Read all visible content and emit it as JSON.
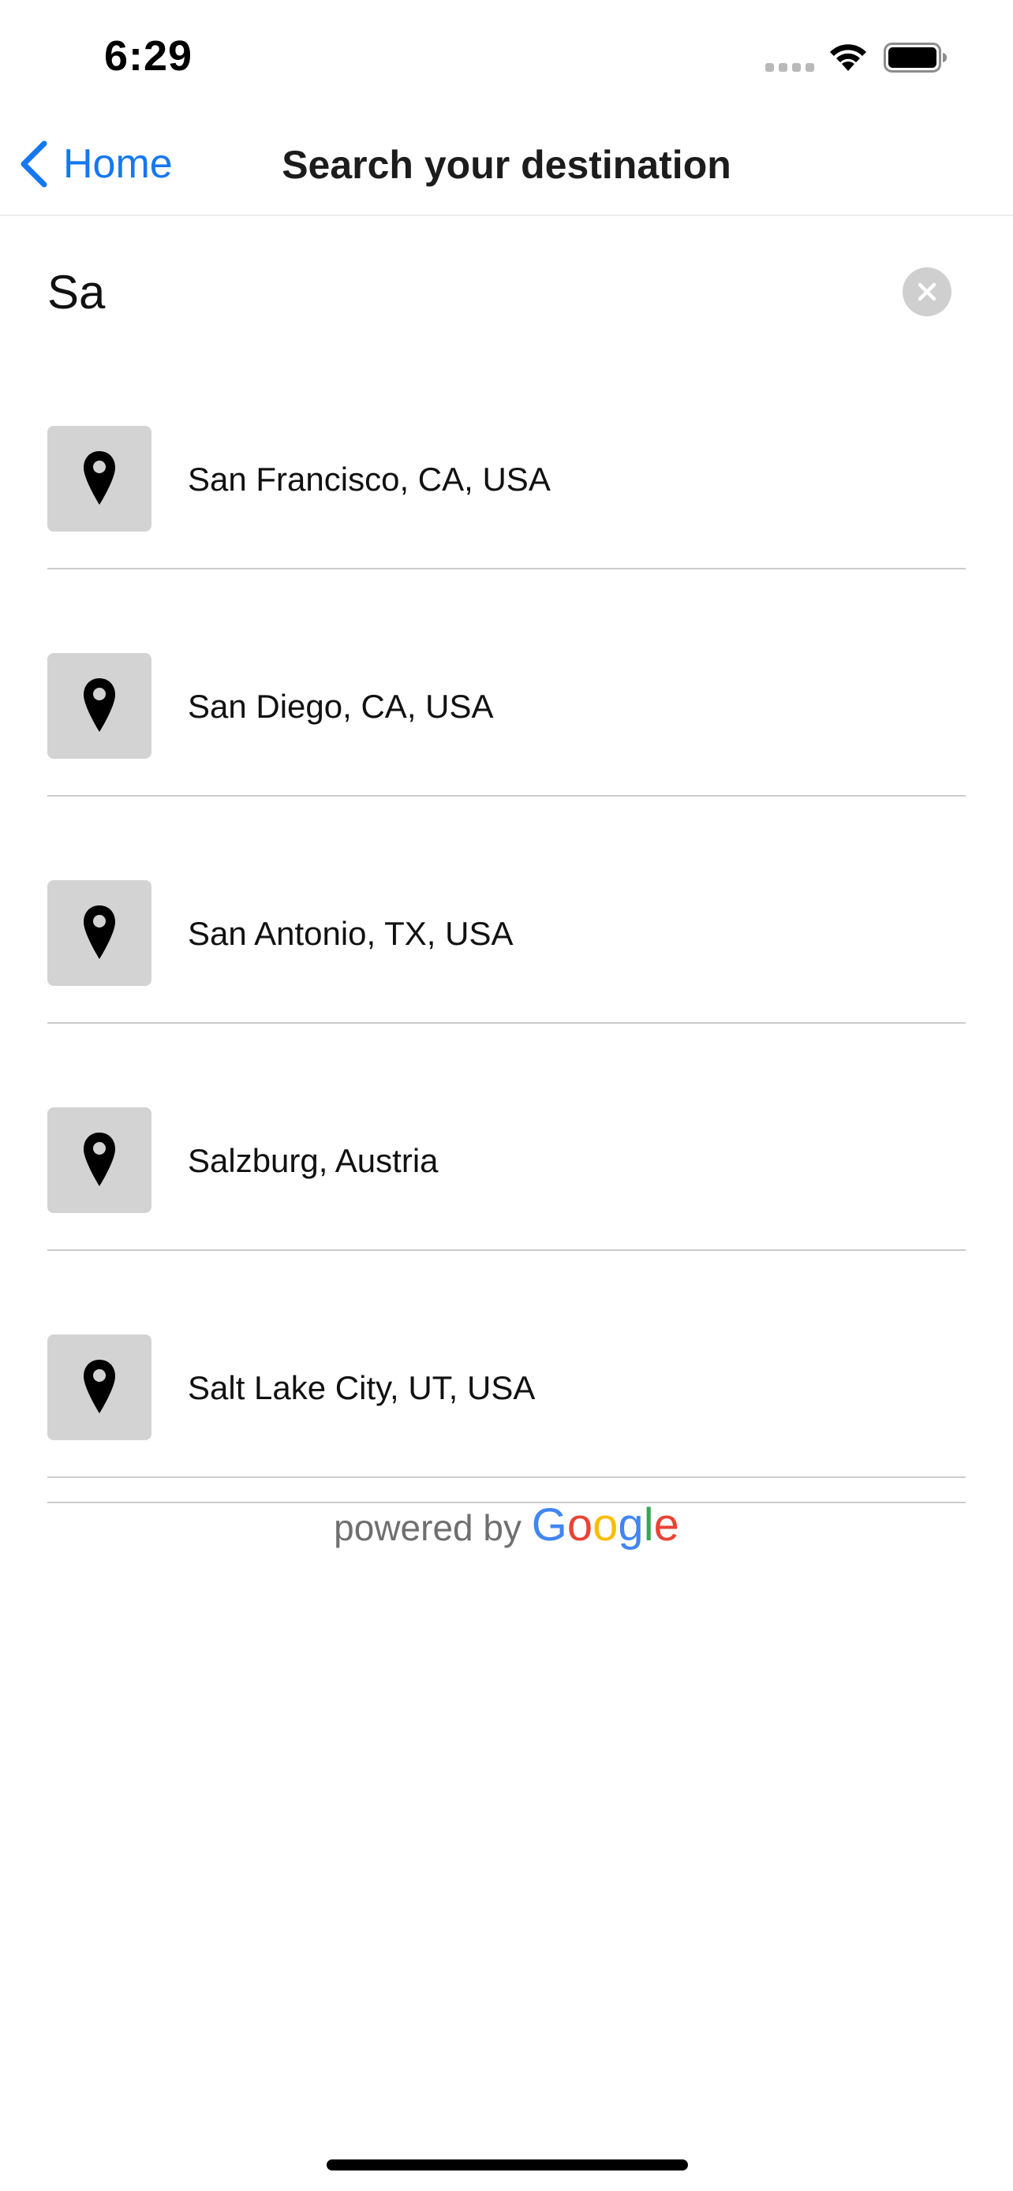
{
  "status_bar": {
    "time": "6:29"
  },
  "nav": {
    "back_label": "Home",
    "title": "Search your destination",
    "accent_color": "#1677f0"
  },
  "search": {
    "value": "Sa",
    "placeholder": ""
  },
  "results": [
    {
      "label": "San Francisco, CA, USA",
      "icon": "map-pin-icon"
    },
    {
      "label": "San Diego, CA, USA",
      "icon": "map-pin-icon"
    },
    {
      "label": "San Antonio, TX, USA",
      "icon": "map-pin-icon"
    },
    {
      "label": "Salzburg, Austria",
      "icon": "map-pin-icon"
    },
    {
      "label": "Salt Lake City, UT, USA",
      "icon": "map-pin-icon"
    }
  ],
  "footer": {
    "powered_by": "powered by",
    "brand_letters": [
      "G",
      "o",
      "o",
      "g",
      "l",
      "e"
    ],
    "brand_colors": [
      "#4285F4",
      "#EA4335",
      "#FBBC05",
      "#4285F4",
      "#34A853",
      "#EA4335"
    ]
  }
}
